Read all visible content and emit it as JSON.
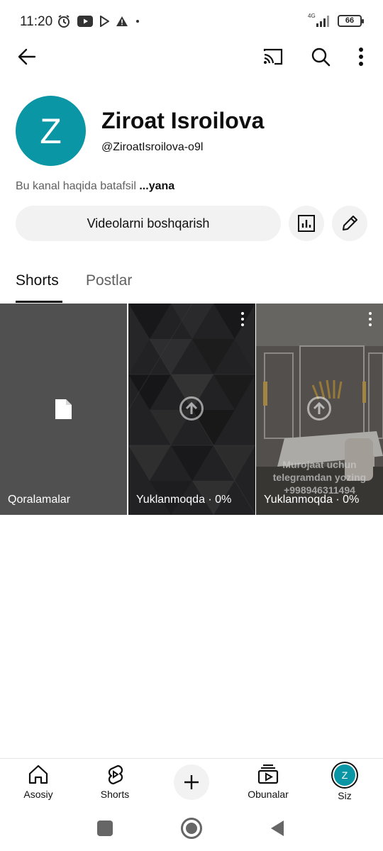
{
  "status_bar": {
    "time": "11:20",
    "network": "4G",
    "battery": "66"
  },
  "channel": {
    "avatar_letter": "Z",
    "avatar_color": "#0a96a4",
    "name": "Ziroat Isroilova",
    "handle": "@ZiroatIsroilova-o9l",
    "description": "Bu kanal haqida batafsil",
    "description_more": "...yana",
    "manage_label": "Videolarni boshqarish"
  },
  "tabs": [
    {
      "label": "Shorts",
      "active": true
    },
    {
      "label": "Postlar",
      "active": false
    }
  ],
  "shorts": [
    {
      "label": "Qoralamalar",
      "icon": "draft-file-icon"
    },
    {
      "label": "Yuklanmoqda · 0%",
      "icon": "upload-icon"
    },
    {
      "label": "Yuklanmoqda · 0%",
      "icon": "upload-icon",
      "watermark": [
        "Murojaat uchun",
        "telegramdan yozing",
        "+998946311494"
      ]
    }
  ],
  "bottom_nav": [
    {
      "label": "Asosiy",
      "icon": "home-icon"
    },
    {
      "label": "Shorts",
      "icon": "shorts-icon"
    },
    {
      "label": "",
      "icon": "create-icon"
    },
    {
      "label": "Obunalar",
      "icon": "subscriptions-icon"
    },
    {
      "label": "Siz",
      "icon": "avatar"
    }
  ]
}
